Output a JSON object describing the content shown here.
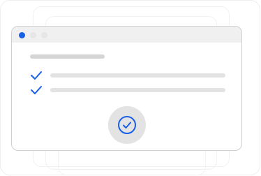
{
  "window": {
    "controls": [
      "close-dot",
      "minimize-dot",
      "maximize-dot"
    ]
  },
  "checklist": {
    "items": [
      {
        "state": "checked",
        "icon": "check-icon"
      },
      {
        "state": "checked",
        "icon": "check-icon"
      }
    ]
  },
  "status": {
    "icon": "check-circle-icon"
  },
  "colors": {
    "accent": "#1a5fe8",
    "placeholder_dark": "#d5d5d5",
    "placeholder_light": "#e3e3e3",
    "titlebar": "#f0f0f0",
    "border": "#cfcfcf"
  }
}
